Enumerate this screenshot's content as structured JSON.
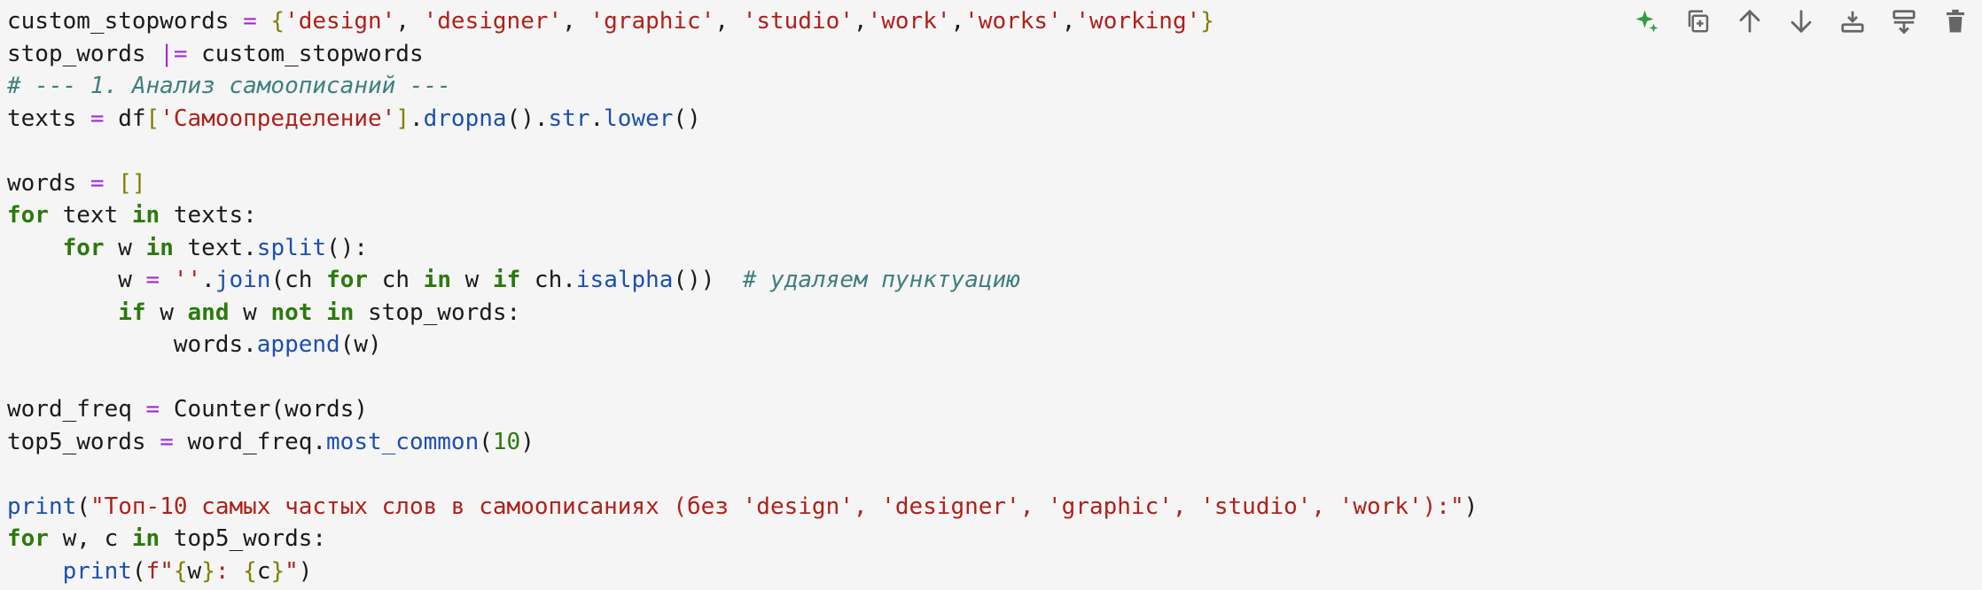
{
  "toolbar": {
    "buttons": [
      {
        "icon": "sparkle-icon",
        "color": "#2e9e3e"
      },
      {
        "icon": "duplicate-icon",
        "color": "#666666"
      },
      {
        "icon": "arrow-up-icon",
        "color": "#666666"
      },
      {
        "icon": "arrow-down-icon",
        "color": "#666666"
      },
      {
        "icon": "insert-below-icon",
        "color": "#666666"
      },
      {
        "icon": "insert-above-icon",
        "color": "#666666"
      },
      {
        "icon": "trash-icon",
        "color": "#666666"
      }
    ]
  },
  "code_lines": [
    [
      [
        "",
        "custom_stopwords "
      ],
      [
        "op",
        "="
      ],
      [
        "",
        " "
      ],
      [
        "br",
        "{"
      ],
      [
        "str",
        "'design'"
      ],
      [
        "",
        ", "
      ],
      [
        "str",
        "'designer'"
      ],
      [
        "",
        ", "
      ],
      [
        "str",
        "'graphic'"
      ],
      [
        "",
        ", "
      ],
      [
        "str",
        "'studio'"
      ],
      [
        "",
        ","
      ],
      [
        "str",
        "'work'"
      ],
      [
        "",
        ","
      ],
      [
        "str",
        "'works'"
      ],
      [
        "",
        ","
      ],
      [
        "str",
        "'working'"
      ],
      [
        "br",
        "}"
      ]
    ],
    [
      [
        "",
        "stop_words "
      ],
      [
        "op",
        "|="
      ],
      [
        "",
        " custom_stopwords"
      ]
    ],
    [
      [
        "cm",
        "# --- 1. Анализ самоописаний ---"
      ]
    ],
    [
      [
        "",
        "texts "
      ],
      [
        "op",
        "="
      ],
      [
        "",
        " df"
      ],
      [
        "br",
        "["
      ],
      [
        "str",
        "'Самоопределение'"
      ],
      [
        "br",
        "]"
      ],
      [
        "",
        "."
      ],
      [
        "fn",
        "dropna"
      ],
      [
        "",
        "()."
      ],
      [
        "fn",
        "str"
      ],
      [
        "",
        "."
      ],
      [
        "fn",
        "lower"
      ],
      [
        "",
        "()"
      ]
    ],
    [],
    [
      [
        "",
        "words "
      ],
      [
        "op",
        "="
      ],
      [
        "",
        " "
      ],
      [
        "br",
        "[]"
      ]
    ],
    [
      [
        "kw",
        "for"
      ],
      [
        "",
        " text "
      ],
      [
        "kw",
        "in"
      ],
      [
        "",
        " texts:"
      ]
    ],
    [
      [
        "",
        "    "
      ],
      [
        "kw",
        "for"
      ],
      [
        "",
        " w "
      ],
      [
        "kw",
        "in"
      ],
      [
        "",
        " text."
      ],
      [
        "fn",
        "split"
      ],
      [
        "",
        "():"
      ]
    ],
    [
      [
        "",
        "        w "
      ],
      [
        "op",
        "="
      ],
      [
        "",
        " "
      ],
      [
        "str",
        "''"
      ],
      [
        "",
        "."
      ],
      [
        "fn",
        "join"
      ],
      [
        "",
        "(ch "
      ],
      [
        "kw",
        "for"
      ],
      [
        "",
        " ch "
      ],
      [
        "kw",
        "in"
      ],
      [
        "",
        " w "
      ],
      [
        "kw",
        "if"
      ],
      [
        "",
        " ch."
      ],
      [
        "fn",
        "isalpha"
      ],
      [
        "",
        "())  "
      ],
      [
        "cm",
        "# удаляем пунктуацию"
      ]
    ],
    [
      [
        "",
        "        "
      ],
      [
        "kw",
        "if"
      ],
      [
        "",
        " w "
      ],
      [
        "kw",
        "and"
      ],
      [
        "",
        " w "
      ],
      [
        "kw",
        "not in"
      ],
      [
        "",
        " stop_words:"
      ]
    ],
    [
      [
        "",
        "            words."
      ],
      [
        "fn",
        "append"
      ],
      [
        "",
        "(w)"
      ]
    ],
    [],
    [
      [
        "",
        "word_freq "
      ],
      [
        "op",
        "="
      ],
      [
        "",
        " Counter(words)"
      ]
    ],
    [
      [
        "",
        "top5_words "
      ],
      [
        "op",
        "="
      ],
      [
        "",
        " word_freq."
      ],
      [
        "fn",
        "most_common"
      ],
      [
        "",
        "("
      ],
      [
        "num",
        "10"
      ],
      [
        "",
        ")"
      ]
    ],
    [],
    [
      [
        "fn",
        "print"
      ],
      [
        "",
        "("
      ],
      [
        "str",
        "\"Топ-10 самых частых слов в самоописаниях (без 'design', 'designer', 'graphic', 'studio', 'work'):\""
      ],
      [
        "",
        ")"
      ]
    ],
    [
      [
        "kw",
        "for"
      ],
      [
        "",
        " w, c "
      ],
      [
        "kw",
        "in"
      ],
      [
        "",
        " top5_words:"
      ]
    ],
    [
      [
        "",
        "    "
      ],
      [
        "fn",
        "print"
      ],
      [
        "",
        "("
      ],
      [
        "str",
        "f\""
      ],
      [
        "br",
        "{"
      ],
      [
        "",
        "w"
      ],
      [
        "br",
        "}"
      ],
      [
        "str",
        ": "
      ],
      [
        "br",
        "{"
      ],
      [
        "",
        "c"
      ],
      [
        "br",
        "}"
      ],
      [
        "str",
        "\""
      ],
      [
        "",
        ")"
      ]
    ]
  ]
}
